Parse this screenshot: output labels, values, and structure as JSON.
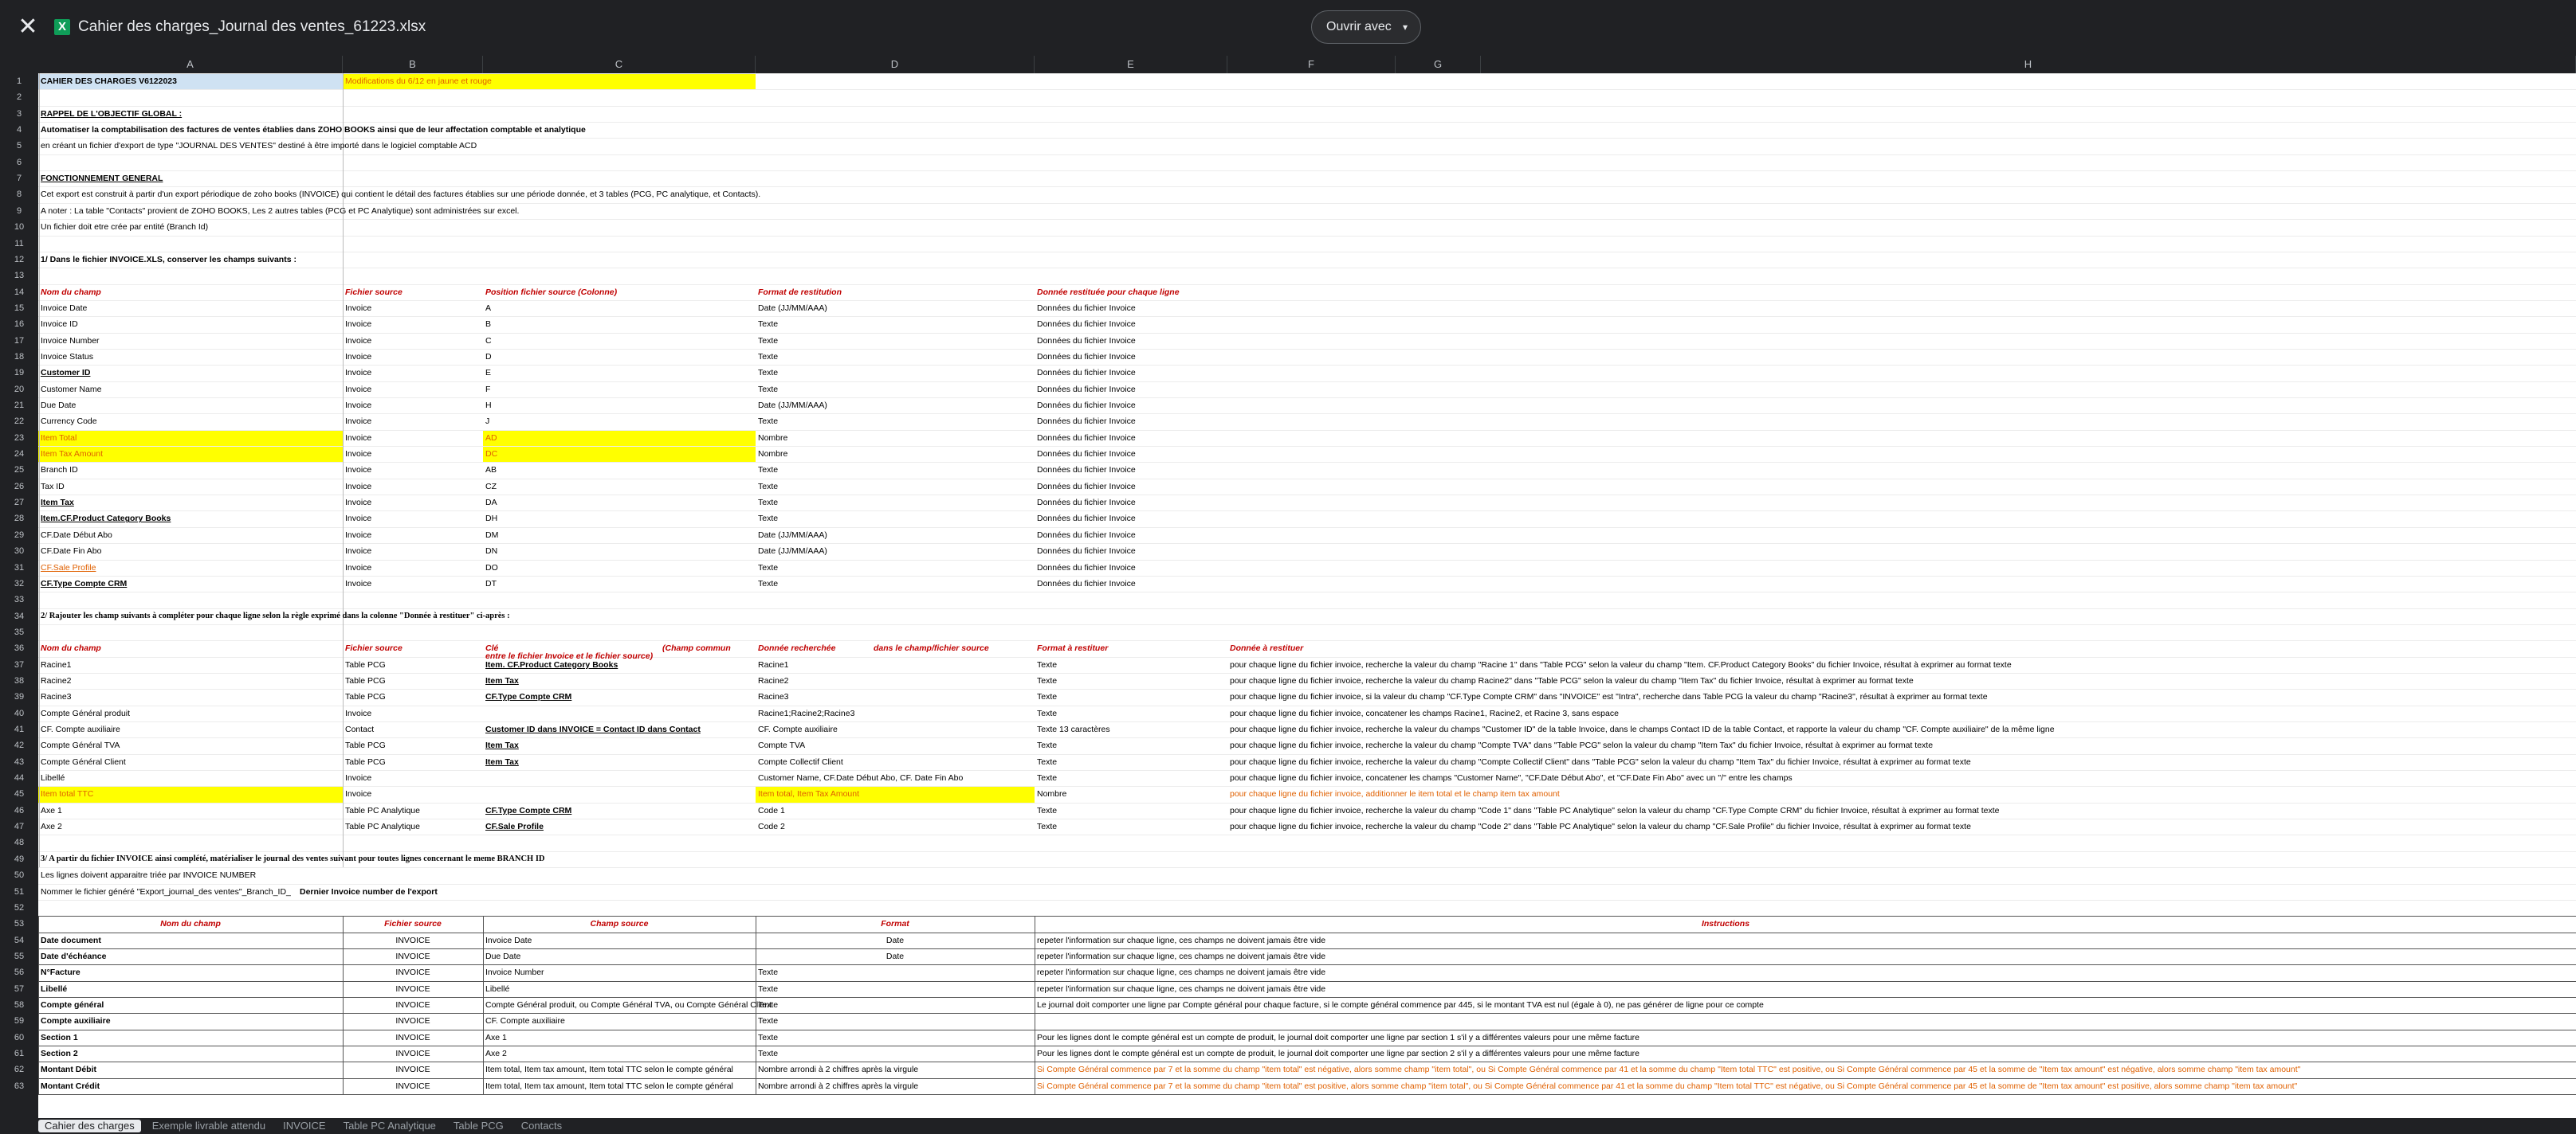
{
  "app": {
    "title": "Cahier des charges_Journal des ventes_61223.xlsx",
    "open_with_label": "Ouvrir avec",
    "close_glyph": "✕",
    "app_glyph": "X",
    "caret_glyph": "▾"
  },
  "columns": [
    "A",
    "B",
    "C",
    "D",
    "E",
    "F",
    "G",
    "H"
  ],
  "rows": [
    1,
    2,
    3,
    4,
    5,
    6,
    7,
    8,
    9,
    10,
    11,
    12,
    13,
    14,
    15,
    16,
    17,
    18,
    19,
    20,
    21,
    22,
    23,
    24,
    25,
    26,
    27,
    28,
    29,
    30,
    31,
    32,
    33,
    34,
    35,
    36,
    37,
    38,
    39,
    40,
    41,
    42,
    43,
    44,
    45,
    46,
    47,
    48,
    49,
    50,
    51,
    52,
    53,
    54,
    55,
    56,
    57,
    58,
    59,
    60,
    61,
    62,
    63
  ],
  "header": {
    "title": "CAHIER DES CHARGES V6122023",
    "modif": "Modifications du 6/12 en jaune et rouge",
    "rappel": "RAPPEL DE L'OBJECTIF GLOBAL :",
    "obj1": "Automatiser la comptabilisation des factures de ventes établies dans ZOHO BOOKS ainsi que de leur affectation comptable et analytique",
    "obj2": "en créant un fichier d'export de type \"JOURNAL DES VENTES\" destiné à être importé dans le logiciel comptable ACD",
    "fonc": "FONCTIONNEMENT GENERAL",
    "fonc1": "Cet export est construit à partir d'un export périodique de zoho books (INVOICE) qui contient le détail des factures établies sur une période donnée, et 3 tables (PCG, PC analytique, et Contacts).",
    "fonc2": "A noter : La table \"Contacts\" provient de ZOHO BOOKS, Les 2 autres tables (PCG et PC Analytique) sont administrées sur excel.",
    "fonc3": "Un fichier doit etre crée par entité (Branch Id)"
  },
  "s1": {
    "title": "1/ Dans le fichier INVOICE.XLS, conserver les champs suivants :",
    "h": [
      "Nom du champ",
      "Fichier source",
      "Position fichier source (Colonne)",
      "Format de restitution",
      "Donnée restituée pour chaque ligne"
    ],
    "rows": [
      [
        "Invoice Date",
        "Invoice",
        "A",
        "Date (JJ/MM/AAA)",
        "Données du fichier Invoice"
      ],
      [
        "Invoice ID",
        "Invoice",
        "B",
        "Texte",
        "Données du fichier Invoice"
      ],
      [
        "Invoice Number",
        "Invoice",
        "C",
        "Texte",
        "Données du fichier Invoice"
      ],
      [
        "Invoice Status",
        "Invoice",
        "D",
        "Texte",
        "Données du fichier Invoice"
      ],
      [
        "Customer ID",
        "Invoice",
        "E",
        "Texte",
        "Données du fichier Invoice"
      ],
      [
        "Customer Name",
        "Invoice",
        "F",
        "Texte",
        "Données du fichier Invoice"
      ],
      [
        "Due Date",
        "Invoice",
        "H",
        "Date (JJ/MM/AAA)",
        "Données du fichier Invoice"
      ],
      [
        "Currency Code",
        "Invoice",
        "J",
        "Texte",
        "Données du fichier Invoice"
      ],
      [
        "Item Total",
        "Invoice",
        "AD",
        "Nombre",
        "Données du fichier Invoice"
      ],
      [
        "Item Tax Amount",
        "Invoice",
        "DC",
        "Nombre",
        "Données du fichier Invoice"
      ],
      [
        "Branch ID",
        "Invoice",
        "AB",
        "Texte",
        "Données du fichier Invoice"
      ],
      [
        "Tax ID",
        "Invoice",
        "CZ",
        "Texte",
        "Données du fichier Invoice"
      ],
      [
        "Item Tax",
        "Invoice",
        "DA",
        "Texte",
        "Données du fichier Invoice"
      ],
      [
        "Item.CF.Product Category Books",
        "Invoice",
        "DH",
        "Texte",
        "Données du fichier Invoice"
      ],
      [
        "CF.Date Début Abo",
        "Invoice",
        "DM",
        "Date (JJ/MM/AAA)",
        "Données du fichier Invoice"
      ],
      [
        "CF.Date Fin Abo",
        "Invoice",
        "DN",
        "Date (JJ/MM/AAA)",
        "Données du fichier Invoice"
      ],
      [
        "CF.Sale Profile",
        "Invoice",
        "DO",
        "Texte",
        "Données du fichier Invoice"
      ],
      [
        "CF.Type Compte CRM",
        "Invoice",
        "DT",
        "Texte",
        "Données du fichier Invoice"
      ]
    ]
  },
  "s2": {
    "title": "2/ Rajouter les champ suivants à compléter pour chaque ligne selon la règle exprimé dans la colonne \"Donnée à restituer\" ci-après :",
    "h": [
      "Nom du champ",
      "Fichier source",
      "Clé",
      "entre le fichier Invoice et le fichier source)",
      "(Champ commun",
      "Donnée recherchée",
      "dans le champ/fichier source",
      "Format à restituer",
      "Donnée à restituer"
    ],
    "rows": [
      [
        "Racine1",
        "Table PCG",
        "Item. CF.Product Category Books",
        "Racine1",
        "Texte",
        "pour chaque ligne du fichier invoice, recherche la valeur du champ \"Racine 1\" dans \"Table PCG\" selon la valeur du champ \"Item. CF.Product Category Books\" du fichier Invoice, résultat à exprimer au format texte"
      ],
      [
        "Racine2",
        "Table PCG",
        "Item Tax",
        "Racine2",
        "Texte",
        "pour chaque ligne du fichier invoice, recherche la valeur du champ Racine2\" dans \"Table PCG\" selon la valeur du champ \"Item Tax\" du fichier Invoice, résultat à exprimer au format texte"
      ],
      [
        "Racine3",
        "Table PCG",
        "CF.Type Compte CRM",
        "Racine3",
        "Texte",
        "pour chaque ligne du fichier invoice, si la valeur du champ \"CF.Type Compte CRM\" dans \"INVOICE\" est \"Intra\", recherche dans Table PCG la valeur du champ \"Racine3\", résultat à exprimer au format texte"
      ],
      [
        "Compte Général produit",
        "Invoice",
        "",
        "Racine1;Racine2;Racine3",
        "Texte",
        "pour chaque ligne du fichier invoice, concatener les champs Racine1, Racine2, et Racine 3, sans espace"
      ],
      [
        "CF. Compte auxiliaire",
        "Contact",
        "Customer ID dans INVOICE = Contact ID dans Contact",
        "CF. Compte auxiliaire",
        "Texte 13 caractères",
        "pour chaque ligne du fichier invoice, recherche la valeur du champs \"Customer ID\" de la table Invoice, dans le champs Contact ID de la table Contact, et rapporte la valeur du champ \"CF. Compte auxiliaire\" de la même ligne"
      ],
      [
        "Compte Général TVA",
        "Table PCG",
        "Item Tax",
        "Compte TVA",
        "Texte",
        "pour chaque ligne du fichier invoice, recherche la valeur du champ \"Compte TVA\" dans \"Table PCG\" selon la valeur du champ \"Item Tax\" du fichier Invoice, résultat à exprimer au format texte"
      ],
      [
        "Compte Général Client",
        "Table PCG",
        "Item Tax",
        "Compte Collectif Client",
        "Texte",
        "pour chaque ligne du fichier invoice, recherche la valeur du champ \"Compte Collectif Client\" dans \"Table PCG\" selon la valeur du champ \"Item Tax\" du fichier Invoice, résultat à exprimer au format texte"
      ],
      [
        "Libellé",
        "Invoice",
        "",
        "Customer Name, CF.Date Début Abo, CF. Date Fin Abo",
        "Texte",
        "pour chaque ligne du fichier invoice, concatener les champs \"Customer Name\", \"CF.Date Début Abo\", et \"CF.Date Fin Abo\" avec un \"/\" entre les champs"
      ],
      [
        "Item total TTC",
        "Invoice",
        "",
        "Item total, Item Tax Amount",
        "Nombre",
        "pour chaque ligne du fichier invoice, additionner le item total et le champ item tax amount"
      ],
      [
        "Axe 1",
        "Table PC Analytique",
        "CF.Type Compte CRM",
        "Code 1",
        "Texte",
        "pour chaque ligne du fichier invoice, recherche la valeur du champ \"Code 1\" dans \"Table PC Analytique\" selon la valeur du champ \"CF.Type Compte CRM\" du fichier Invoice, résultat à exprimer au format texte"
      ],
      [
        "Axe 2",
        "Table PC Analytique",
        "CF.Sale Profile",
        "Code 2",
        "Texte",
        "pour chaque ligne du fichier invoice, recherche la valeur du champ \"Code 2\" dans \"Table PC Analytique\" selon la valeur du champ \"CF.Sale Profile\" du fichier Invoice, résultat à exprimer au format texte"
      ]
    ]
  },
  "s3": {
    "title": "3/ A partir du fichier INVOICE ainsi complété, matérialiser le journal des ventes suivant pour toutes lignes concernant le meme BRANCH ID",
    "sub1": "Les lignes doivent apparaitre triée par INVOICE NUMBER",
    "sub2a": "Nommer le fichier généré \"Export_journal_des ventes\"_Branch_ID_",
    "sub2b": "Dernier Invoice number de l'export",
    "h": [
      "Nom du champ",
      "Fichier source",
      "Champ source",
      "Format",
      "Instructions"
    ],
    "rows": [
      [
        "Date document",
        "INVOICE",
        "Invoice Date",
        "Date",
        "repeter l'information sur chaque ligne, ces champs ne doivent jamais être vide"
      ],
      [
        "Date d'échéance",
        "INVOICE",
        "Due Date",
        "Date",
        "repeter l'information sur chaque ligne, ces champs ne doivent jamais être vide"
      ],
      [
        "N°Facture",
        "INVOICE",
        "Invoice Number",
        "Texte",
        "repeter l'information sur chaque ligne, ces champs ne doivent jamais être vide"
      ],
      [
        "Libellé",
        "INVOICE",
        "Libellé",
        "Texte",
        "repeter l'information sur chaque ligne, ces champs ne doivent jamais être vide"
      ],
      [
        "Compte général",
        "INVOICE",
        "Compte Général produit, ou Compte Général TVA, ou Compte Général Client",
        "Texte",
        "Le journal doit comporter une ligne par Compte général pour chaque facture, si le compte général commence par 445, si le montant TVA est nul (égale à 0), ne pas générer de ligne pour ce compte"
      ],
      [
        "Compte auxiliaire",
        "INVOICE",
        "CF. Compte auxiliaire",
        "Texte",
        ""
      ],
      [
        "Section 1",
        "INVOICE",
        "Axe 1",
        "Texte",
        "Pour les lignes dont le compte général est un compte de produit, le journal doit comporter une ligne par section 1 s'il y a différentes valeurs pour une même facture"
      ],
      [
        "Section 2",
        "INVOICE",
        "Axe 2",
        "Texte",
        "Pour les lignes dont le compte général est un compte de produit, le journal doit comporter une ligne par section 2 s'il y a différentes valeurs pour une même facture"
      ],
      [
        "Montant Débit",
        "INVOICE",
        "Item total, Item tax amount, Item total TTC selon le compte général",
        "Nombre arrondi à 2 chiffres après la virgule",
        "Si Compte Général commence par 7 et la somme du champ \"item total\" est négative, alors somme champ \"item total\", ou Si Compte Général commence par 41 et la somme du champ \"Item total TTC\" est positive, ou Si Compte Général commence par 45 et la somme de \"Item tax amount\" est négative, alors somme champ \"item tax amount\""
      ],
      [
        "Montant Crédit",
        "INVOICE",
        "Item total, Item tax amount, Item total TTC selon le compte général",
        "Nombre arrondi à 2 chiffres après la virgule",
        "Si Compte Général commence par 7 et la somme du champ \"item total\" est positive, alors somme champ \"item total\", ou Si Compte Général commence par 41 et la somme du champ \"Item total TTC\" est négative, ou Si Compte Général commence par 45 et la somme de \"Item tax amount\" est positive, alors somme champ \"item tax amount\""
      ]
    ]
  },
  "tabs": [
    "Cahier des charges",
    "Exemple livrable attendu",
    "INVOICE",
    "Table PC Analytique",
    "Table PCG",
    "Contacts"
  ]
}
